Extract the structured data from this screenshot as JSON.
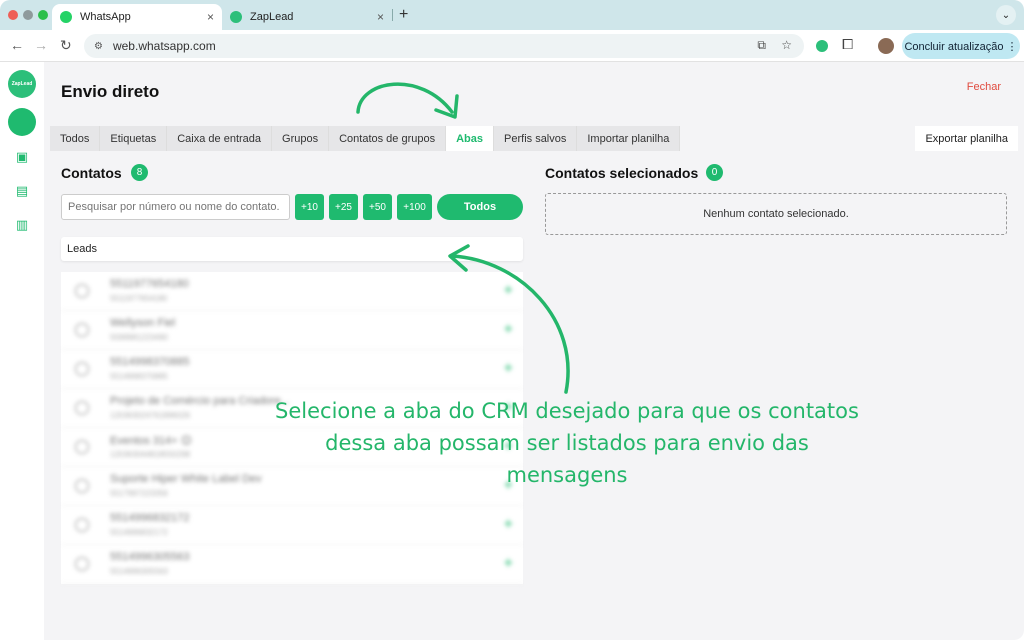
{
  "browser": {
    "tabs": [
      {
        "title": "WhatsApp",
        "close": "×"
      },
      {
        "title": "ZapLead",
        "close": "×"
      }
    ],
    "new_tab": "+",
    "tab_menu": "⌄",
    "url": "web.whatsapp.com",
    "update_button": "Concluir atualização ⋮"
  },
  "sidebar": {
    "logo": "ZapLead"
  },
  "page": {
    "title": "Envio direto",
    "close": "Fechar"
  },
  "tabs": [
    "Todos",
    "Etiquetas",
    "Caixa de entrada",
    "Grupos",
    "Contatos de grupos",
    "Abas",
    "Perfis salvos",
    "Importar planilha"
  ],
  "export_tab": "Exportar planilha",
  "contacts": {
    "title": "Contatos",
    "count": "8",
    "search_placeholder": "Pesquisar por número ou nome do contato.",
    "quick_buttons": [
      "+10",
      "+25",
      "+50",
      "+100"
    ],
    "all_button": "Todos",
    "list_select": "Leads",
    "rows": [
      {
        "name": "5511977654180",
        "number": "5511977654180"
      },
      {
        "name": "Wellyson Fiel",
        "number": "5599981223490"
      },
      {
        "name": "5514998370885",
        "number": "5514998370885"
      },
      {
        "name": "Projeto de Comércio para Criadore...",
        "number": "120363024761896026"
      },
      {
        "name": "Eventos 314+ 😊",
        "number": "120363044818550298"
      },
      {
        "name": "Suporte Hiper White Label Dev",
        "number": "5517997223356"
      },
      {
        "name": "5514996832172",
        "number": "5514996832172"
      },
      {
        "name": "5514996305563",
        "number": "5514996305563"
      }
    ],
    "add_symbol": "+"
  },
  "selected": {
    "title": "Contatos selecionados",
    "count": "0",
    "empty_text": "Nenhum contato selecionado."
  },
  "callout": {
    "text": "Selecione a aba do CRM desejado para que os contatos dessa aba possam ser listados para envio das mensagens"
  },
  "colors": {
    "accent": "#1fba6f",
    "close_red": "#e04b3f",
    "callout_green": "#24b66a"
  }
}
